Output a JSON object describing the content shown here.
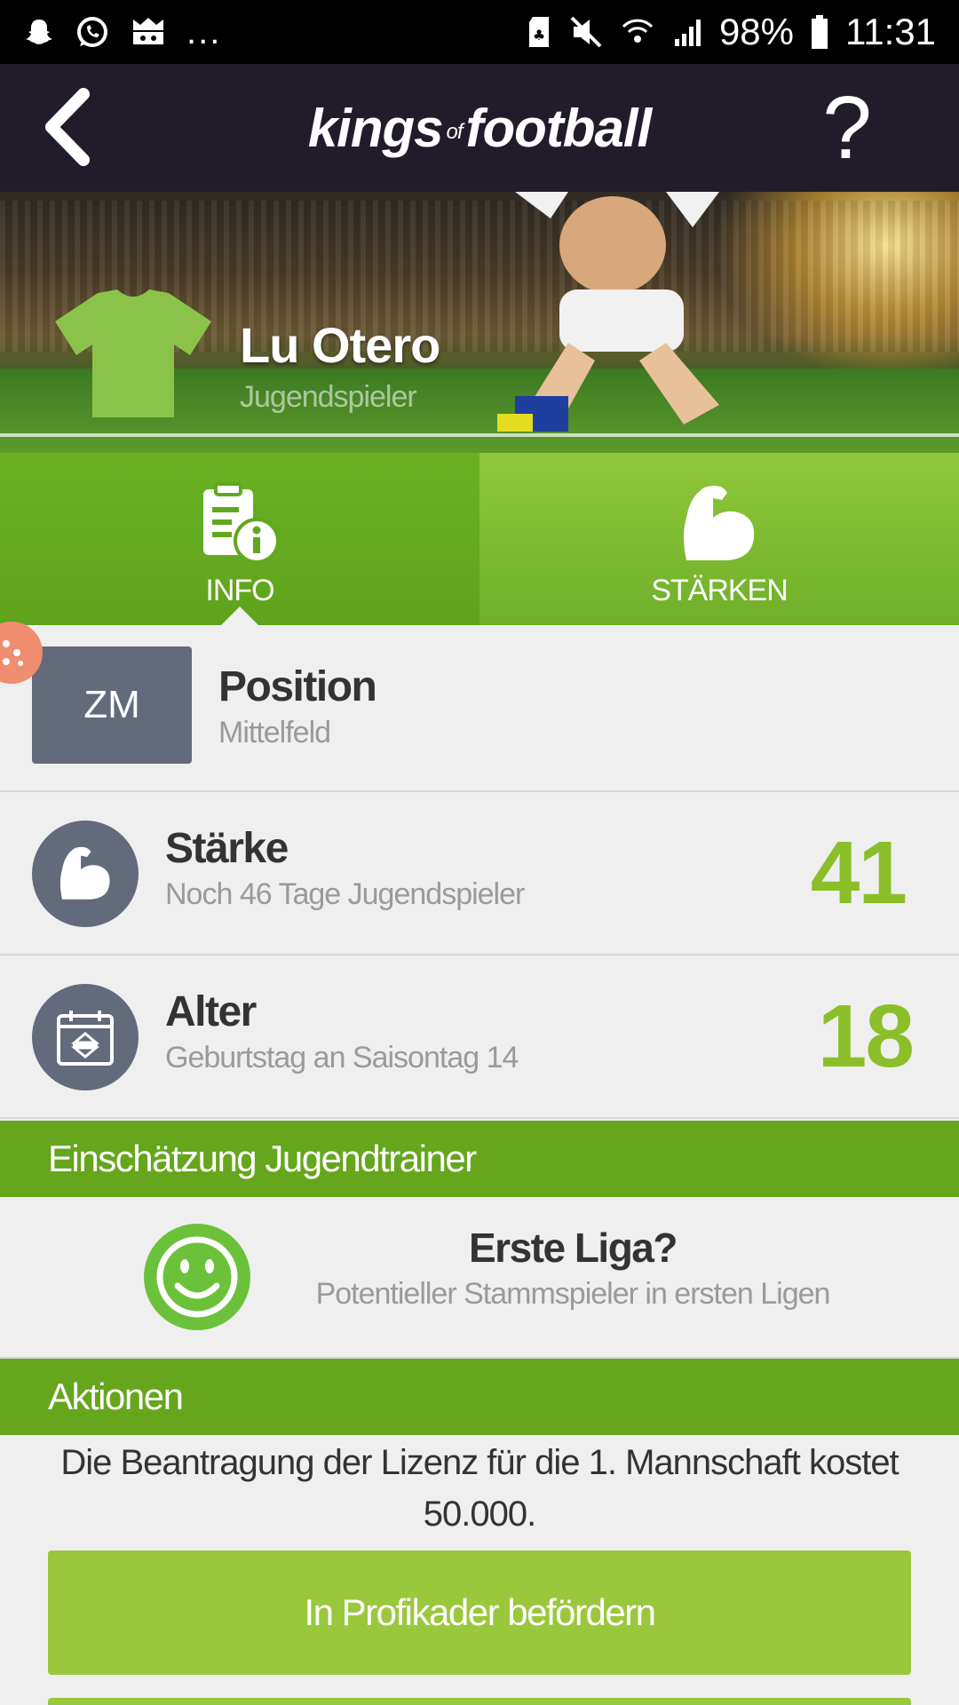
{
  "status_bar": {
    "left_icons": [
      "snapchat-icon",
      "whatsapp-icon",
      "game-icon"
    ],
    "more": "...",
    "battery": "98%",
    "time": "11:31"
  },
  "header": {
    "logo_left": "kings",
    "logo_of": "of",
    "logo_right": "football",
    "help": "?"
  },
  "player": {
    "name": "Lu Otero",
    "type": "Jugendspieler",
    "jersey_color": "#8bc34a"
  },
  "tabs": [
    {
      "label": "INFO",
      "icon": "info-document-icon",
      "active": true
    },
    {
      "label": "STÄRKEN",
      "icon": "muscle-arm-icon",
      "active": false
    }
  ],
  "position": {
    "code": "ZM",
    "title": "Position",
    "subtitle": "Mittelfeld"
  },
  "staerke": {
    "title": "Stärke",
    "subtitle": "Noch 46 Tage Jugendspieler",
    "value": "41"
  },
  "alter": {
    "title": "Alter",
    "subtitle": "Geburtstag an Saisontag 14",
    "value": "18"
  },
  "sections": {
    "trainer": "Einschätzung Jugendtrainer",
    "aktionen": "Aktionen"
  },
  "assessment": {
    "title": "Erste Liga?",
    "subtitle": "Potentieller Stammspieler in ersten Ligen"
  },
  "actions": {
    "description": "Die Beantragung der Lizenz für die 1. Mannschaft kostet 50.000.",
    "promote_button": "In Profikader befördern"
  },
  "colors": {
    "primary_green": "#65a61c",
    "value_green": "#8bbf2a",
    "header_dark": "#221c2a",
    "icon_gray": "#636a7c"
  }
}
